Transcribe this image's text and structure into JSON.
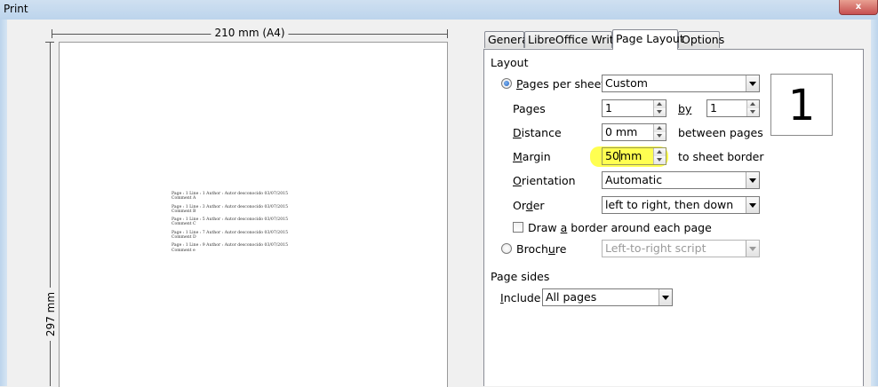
{
  "window": {
    "title": "Print",
    "close": "x"
  },
  "preview": {
    "width_label": "210 mm (A4)",
    "height_label": "297 mm",
    "entries": [
      {
        "line1": "Page : 1 Line : 1 Author : Autor desconocido 03/07/2015",
        "line2": "Comment A"
      },
      {
        "line1": "Page : 1 Line : 3 Author : Autor desconocido 03/07/2015",
        "line2": "Comment B"
      },
      {
        "line1": "Page : 1 Line : 5 Author : Autor desconocido 03/07/2015",
        "line2": "Comment C"
      },
      {
        "line1": "Page : 1 Line : 7 Author : Autor desconocido 03/07/2015",
        "line2": "Comment D"
      },
      {
        "line1": "Page : 1 Line : 9 Author : Autor desconocido 03/07/2015",
        "line2": "Comment e"
      }
    ]
  },
  "tabs": [
    "General",
    "LibreOffice Writer",
    "Page Layout",
    "Options"
  ],
  "layout": {
    "heading": "Layout",
    "pages_per_sheet": {
      "label_pre": "P",
      "label_post": "ages per sheet",
      "value": "Custom"
    },
    "pages": {
      "label": "Pages",
      "value": "1",
      "by_label": "by",
      "by_value": "1"
    },
    "distance": {
      "label_pre": "D",
      "label_post": "istance",
      "value": "0 mm",
      "suffix": "between pages"
    },
    "margin": {
      "label_pre": "M",
      "label_post": "argin",
      "value_a": "50",
      "value_b": "mm",
      "suffix": "to sheet border"
    },
    "orientation": {
      "label_pre": "O",
      "label_post": "rientation",
      "value": "Automatic"
    },
    "order": {
      "label_pre": "Or",
      "label_u": "d",
      "label_post": "er",
      "value": "left to right, then down"
    },
    "border": {
      "label_pre": "Draw ",
      "label_u": "a",
      "label_post": " border around each page"
    },
    "brochure": {
      "label_pre": "Broch",
      "label_u": "u",
      "label_post": "re",
      "value": "Left-to-right script"
    },
    "page_count_preview": "1"
  },
  "page_sides": {
    "heading": "Page sides",
    "include": {
      "label_pre": "I",
      "label_post": "nclude",
      "value": "All pages"
    }
  },
  "colors": {
    "highlight": "#ffff33",
    "accent": "#1f5fbf"
  }
}
